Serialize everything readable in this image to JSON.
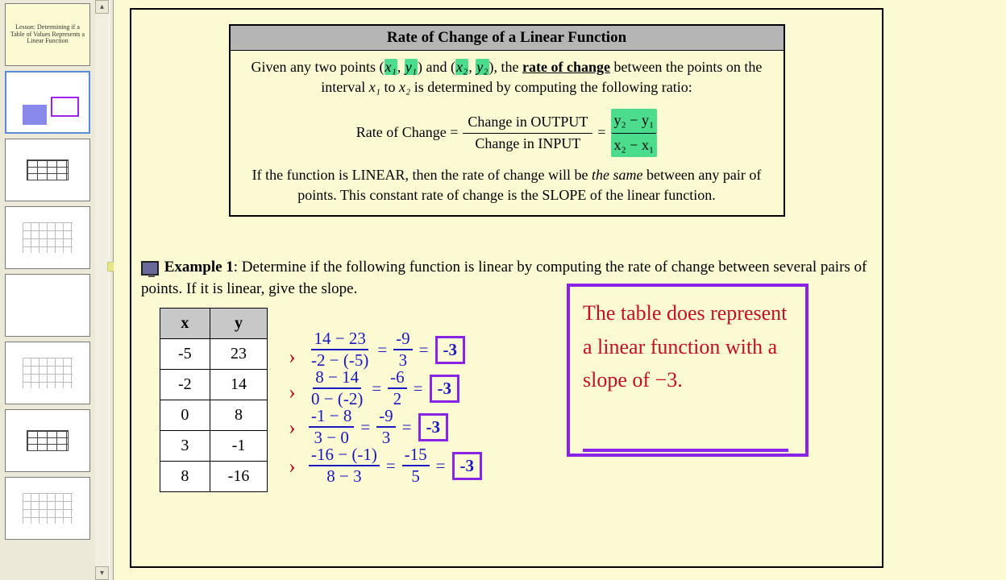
{
  "lesson_title": "Lesson: Determining if a Table of Values Represents a Linear Function",
  "definition": {
    "title": "Rate of Change of a Linear Function",
    "line1a": "Given any two points (",
    "pt1x": "x₁",
    "pt1y": "y₁",
    "line1b": ") and (",
    "pt2x": "x₂",
    "pt2y": "y₂",
    "line1c": "),  the ",
    "roc_label": "rate of change",
    "line1d": " between the points on the interval ",
    "int1": "x₁",
    "to": " to ",
    "int2": "x₂",
    "line1e": "  is determined by computing the following ratio:",
    "formula_left": "Rate of Change =",
    "formula_num": "Change in OUTPUT",
    "formula_den": "Change in INPUT",
    "eq": " = ",
    "roc_num": "y₂ − y₁",
    "roc_den": "x₂ − x₁",
    "line2a": "If the function is LINEAR, then the rate of change will be ",
    "same": "the same",
    "line2b": " between any pair of points. This constant rate of change is the SLOPE of the linear function."
  },
  "example": {
    "label": "Example 1",
    "text": ":  Determine if the following function is linear by computing the rate of change between several pairs of points.  If it is linear, give the slope."
  },
  "table": {
    "hx": "x",
    "hy": "y",
    "rows": [
      {
        "x": "-5",
        "y": "23"
      },
      {
        "x": "-2",
        "y": "14"
      },
      {
        "x": "0",
        "y": "8"
      },
      {
        "x": "3",
        "y": "-1"
      },
      {
        "x": "8",
        "y": "-16"
      }
    ]
  },
  "work": {
    "rows": [
      {
        "fn": "14 − 23",
        "fd": "-2 − (-5)",
        "sn": "-9",
        "sd": "3",
        "r": "-3"
      },
      {
        "fn": "8 − 14",
        "fd": "0 − (-2)",
        "sn": "-6",
        "sd": "2",
        "r": "-3"
      },
      {
        "fn": "-1 − 8",
        "fd": "3 − 0",
        "sn": "-9",
        "sd": "3",
        "r": "-3"
      },
      {
        "fn": "-16 − (-1)",
        "fd": "8 − 3",
        "sn": "-15",
        "sd": "5",
        "r": "-3"
      }
    ]
  },
  "conclusion": "The table does represent a linear function with a slope of −3.",
  "chart_data": {
    "type": "table",
    "title": "Example 1 – table of values and computed rates of change",
    "columns": [
      "x",
      "y"
    ],
    "rows": [
      [
        -5,
        23
      ],
      [
        -2,
        14
      ],
      [
        0,
        8
      ],
      [
        3,
        -1
      ],
      [
        8,
        -16
      ]
    ],
    "rate_of_change_between_consecutive_rows": [
      -3,
      -3,
      -3,
      -3
    ],
    "slope": -3,
    "is_linear": true
  }
}
